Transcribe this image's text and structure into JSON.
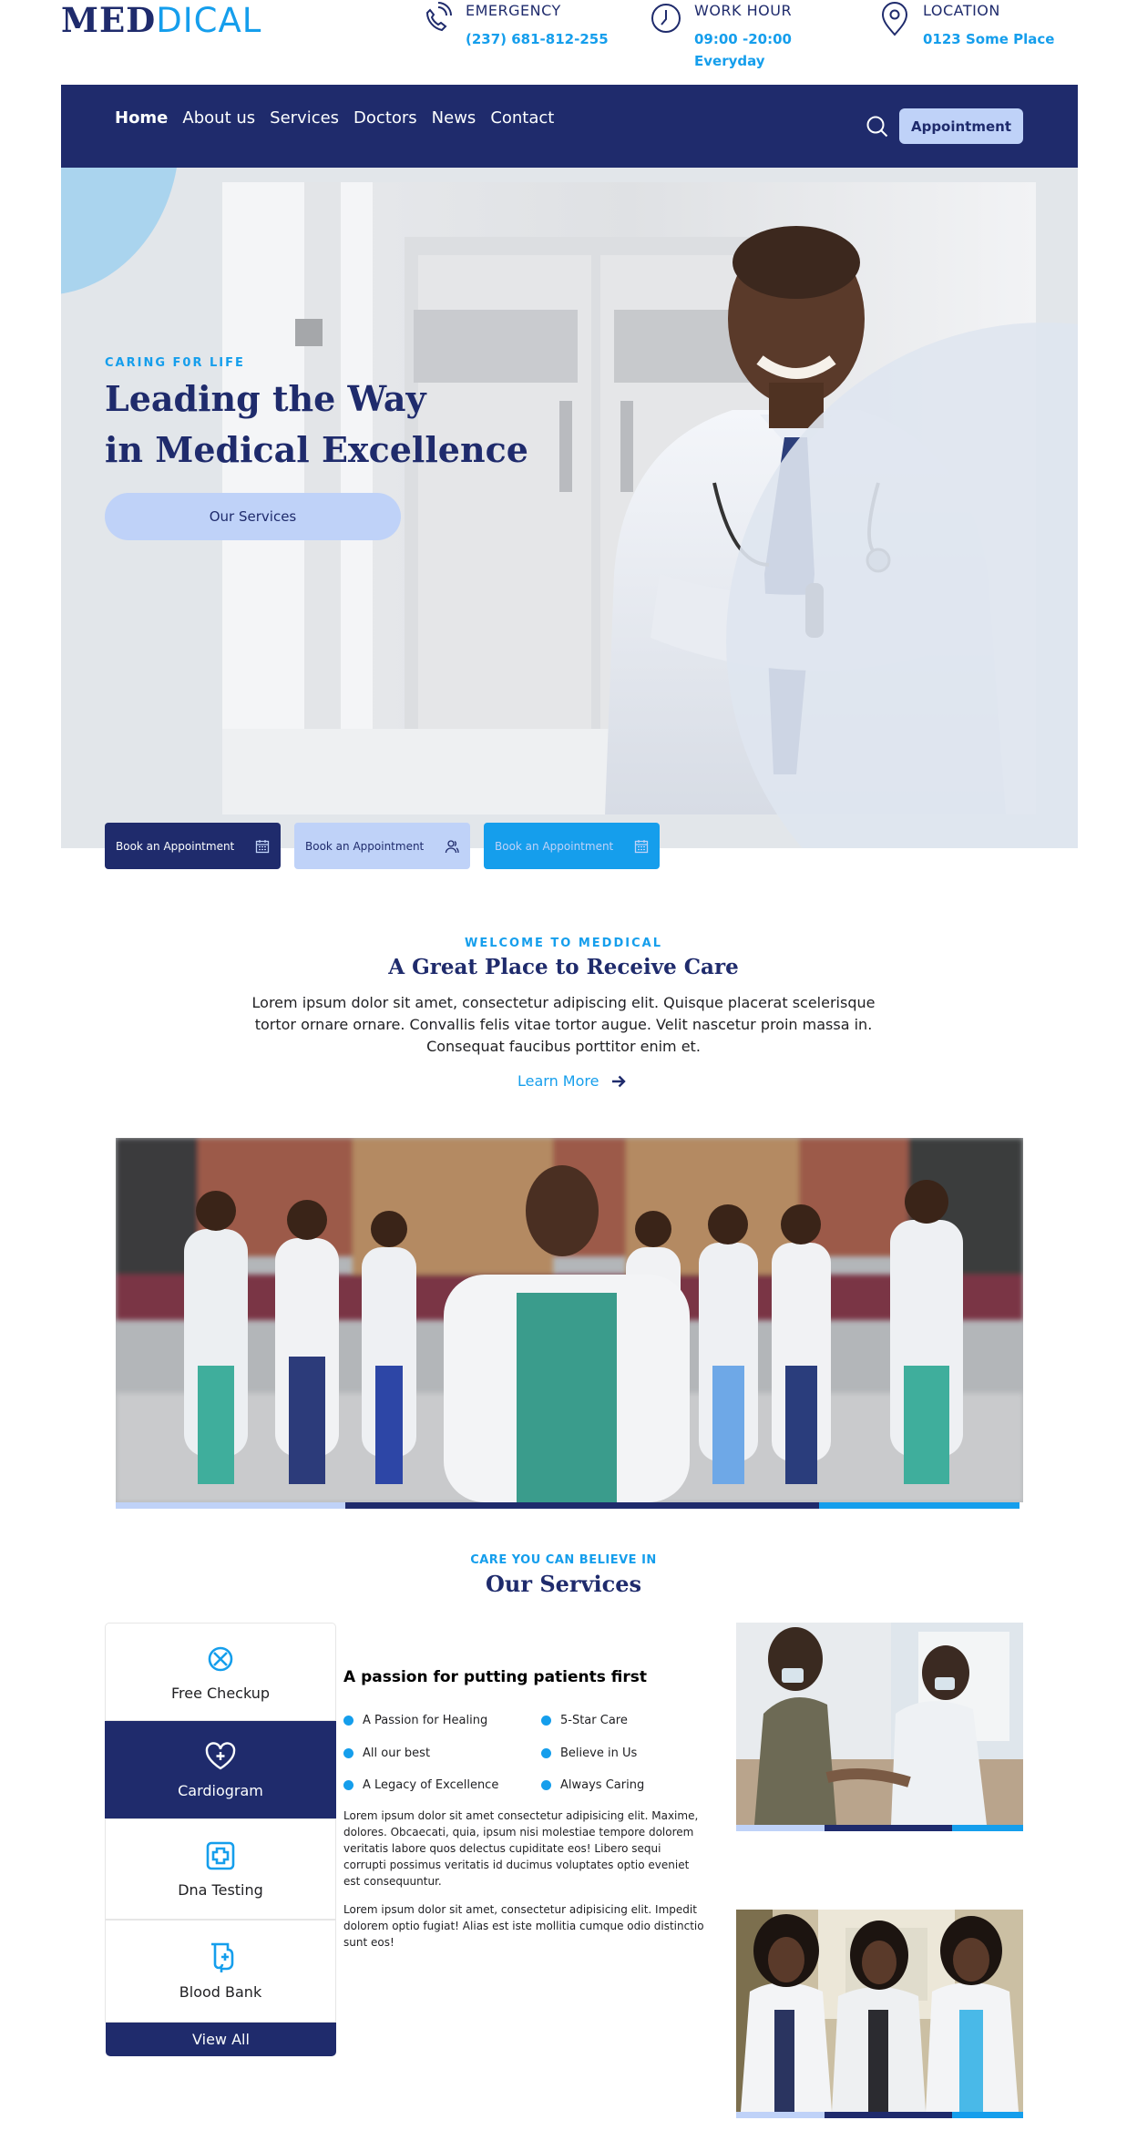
{
  "brand": {
    "logo_part1": "MED",
    "logo_part2": "DICAL"
  },
  "topinfo": [
    {
      "label": "EMERGENCY",
      "value": "(237) 681-812-255",
      "icon": "phone-icon"
    },
    {
      "label": "WORK HOUR",
      "value": "09:00 -20:00 Everyday",
      "icon": "clock-icon"
    },
    {
      "label": "LOCATION",
      "value": "0123 Some Place",
      "icon": "location-pin-icon"
    }
  ],
  "nav": {
    "links": [
      "Home",
      "About us",
      "Services",
      "Doctors",
      "News",
      "Contact"
    ],
    "active": "Home",
    "appointment": "Appointment"
  },
  "hero": {
    "subtitle": "CARING F0R LIFE",
    "title_line1": "Leading the Way",
    "title_line2": "in Medical Excellence",
    "button": "Our Services"
  },
  "booking": [
    {
      "label": "Book an Appointment",
      "icon": "calendar-icon"
    },
    {
      "label": "Book an Appointment",
      "icon": "user-group-icon"
    },
    {
      "label": "Book an Appointment",
      "icon": "calendar-icon"
    }
  ],
  "welcome": {
    "subtitle": "WELCOME TO MEDDICAL",
    "title": "A Great Place to Receive Care",
    "text": "Lorem ipsum dolor sit amet, consectetur adipiscing elit. Quisque placerat scelerisque tortor ornare ornare. Convallis felis vitae tortor augue. Velit nascetur proin massa in. Consequat faucibus porttitor enim et.",
    "link": "Learn More"
  },
  "services": {
    "subtitle": "CARE YOU CAN BELIEVE IN",
    "title": "Our Services",
    "items": [
      {
        "label": "Free Checkup",
        "icon": "stethoscope-icon"
      },
      {
        "label": "Cardiogram",
        "icon": "heart-pulse-icon"
      },
      {
        "label": "Dna Testing",
        "icon": "medical-cross-icon"
      },
      {
        "label": "Blood Bank",
        "icon": "blood-bag-icon"
      }
    ],
    "active": "Cardiogram",
    "view_all": "View All",
    "heading": "A passion for putting patients first",
    "features": [
      "A Passion for Healing",
      "5-Star Care",
      "All our best",
      "Believe in Us",
      "A Legacy of Excellence",
      "Always Caring"
    ],
    "para1": "Lorem ipsum dolor sit amet consectetur adipisicing elit. Maxime, dolores. Obcaecati, quia, ipsum nisi molestiae tempore dolorem veritatis labore quos delectus cupiditate eos! Libero sequi corrupti possimus veritatis id ducimus voluptates optio eveniet est consequuntur.",
    "para2": "Lorem ipsum dolor sit amet, consectetur adipisicing elit. Impedit dolorem optio fugiat! Alias est iste mollitia cumque odio distinctio sunt eos!"
  },
  "colors": {
    "primary": "#1f2b6c",
    "accent": "#159eec",
    "light": "#bfd2f8"
  }
}
